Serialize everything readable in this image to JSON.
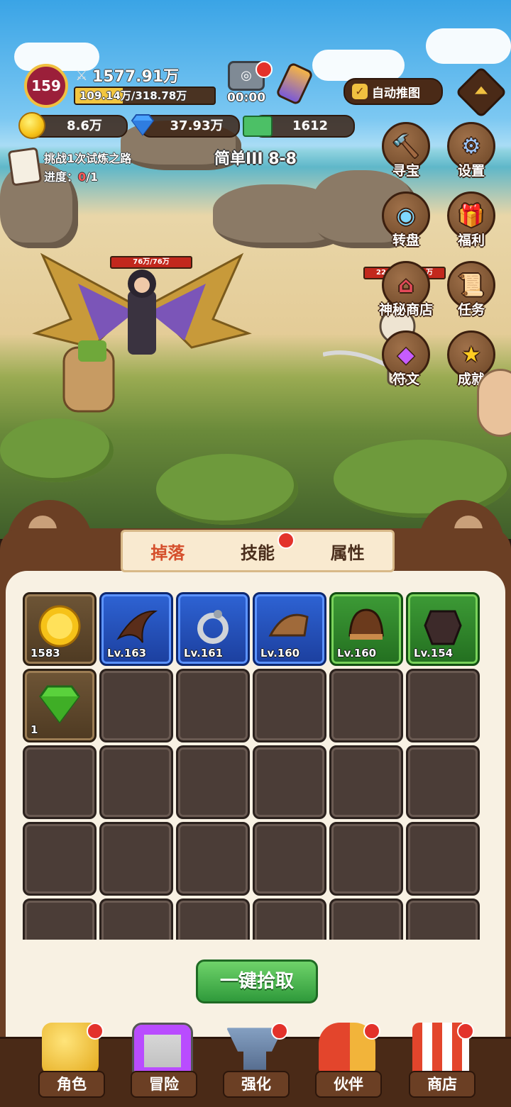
{
  "hud": {
    "level": "159",
    "power": "1577.91万",
    "exp": "109.14万/318.78万",
    "exp_fraction": 0.342,
    "timer": "00:00",
    "auto_push_label": "自动推图",
    "gold": "8.6万",
    "diamond": "37.93万",
    "cash": "1612"
  },
  "quest": {
    "title": "挑战1次试炼之路",
    "progress_label": "进度：",
    "progress_current": "0",
    "progress_total": "/1"
  },
  "stage": "简单III 8-8",
  "battle": {
    "hero_hp": "76万/76万",
    "enemy_hp": "22",
    "enemy_hp_suffix": "万"
  },
  "side_menu": {
    "treasure": "寻宝",
    "settings": "设置",
    "wheel": "转盘",
    "welfare": "福利",
    "mystery_shop": "神秘商店",
    "tasks": "任务",
    "runes": "符文",
    "achievements": "成就"
  },
  "tabs": [
    "掉落",
    "技能",
    "属性"
  ],
  "drops": [
    {
      "label": "1583",
      "rarity": "brown",
      "icon": "gold-coin-icon"
    },
    {
      "label": "Lv.163",
      "rarity": "blue",
      "icon": "blade-icon"
    },
    {
      "label": "Lv.161",
      "rarity": "blue",
      "icon": "ring-icon"
    },
    {
      "label": "Lv.160",
      "rarity": "blue",
      "icon": "shoulder-armor-icon"
    },
    {
      "label": "Lv.160",
      "rarity": "green",
      "icon": "helmet-icon"
    },
    {
      "label": "Lv.154",
      "rarity": "green",
      "icon": "armor-icon"
    },
    {
      "label": "1",
      "rarity": "brown",
      "icon": "green-gem-icon"
    }
  ],
  "pick_all": "一键拾取",
  "nav": [
    "角色",
    "冒险",
    "强化",
    "伙伴",
    "商店"
  ],
  "colors": {
    "accent_red": "#d54f2c",
    "panel_brown": "#6b3f24",
    "blue_rarity": "#2e63d4",
    "green_rarity": "#3d9b36"
  }
}
